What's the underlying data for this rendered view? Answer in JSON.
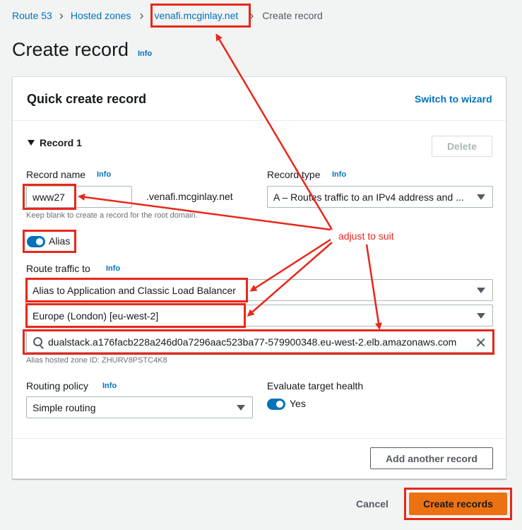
{
  "breadcrumb": {
    "items": [
      "Route 53",
      "Hosted zones",
      "venafi.mcginlay.net"
    ],
    "current": "Create record"
  },
  "page": {
    "title": "Create record",
    "info": "Info"
  },
  "panel": {
    "title": "Quick create record",
    "switch_wizard": "Switch to wizard"
  },
  "record": {
    "heading": "Record 1",
    "delete_label": "Delete",
    "name_label": "Record name",
    "name_info": "Info",
    "name_value": "www27",
    "domain_suffix": ".venafi.mcginlay.net",
    "name_hint": "Keep blank to create a record for the root domain.",
    "type_label": "Record type",
    "type_info": "Info",
    "type_value": "A – Routes traffic to an IPv4 address and ...",
    "alias_label": "Alias",
    "alias_on": true,
    "route_label": "Route traffic to",
    "route_info": "Info",
    "route_endpoint": "Alias to Application and Classic Load Balancer",
    "route_region": "Europe (London) [eu-west-2]",
    "route_target": "dualstack.a176facb228a246d0a7296aac523ba77-579900348.eu-west-2.elb.amazonaws.com",
    "alias_zone_id": "Alias hosted zone ID: ZHURV8PSTC4K8",
    "policy_label": "Routing policy",
    "policy_info": "Info",
    "policy_value": "Simple routing",
    "health_label": "Evaluate target health",
    "health_value": "Yes",
    "health_on": true
  },
  "actions": {
    "add_another": "Add another record",
    "cancel": "Cancel",
    "create": "Create records"
  },
  "annotation": {
    "text": "adjust to suit"
  },
  "colors": {
    "accent": "#0073bb",
    "primary": "#ec7211",
    "annotation": "#e8271a"
  }
}
